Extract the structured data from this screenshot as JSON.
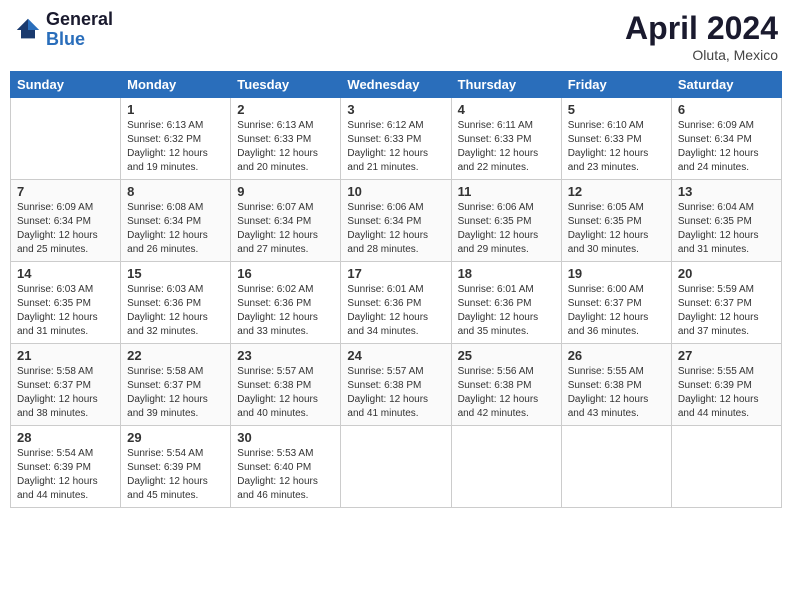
{
  "header": {
    "logo_line1": "General",
    "logo_line2": "Blue",
    "month_year": "April 2024",
    "location": "Oluta, Mexico"
  },
  "days_of_week": [
    "Sunday",
    "Monday",
    "Tuesday",
    "Wednesday",
    "Thursday",
    "Friday",
    "Saturday"
  ],
  "weeks": [
    [
      {
        "day": "",
        "info": ""
      },
      {
        "day": "1",
        "info": "Sunrise: 6:13 AM\nSunset: 6:32 PM\nDaylight: 12 hours\nand 19 minutes."
      },
      {
        "day": "2",
        "info": "Sunrise: 6:13 AM\nSunset: 6:33 PM\nDaylight: 12 hours\nand 20 minutes."
      },
      {
        "day": "3",
        "info": "Sunrise: 6:12 AM\nSunset: 6:33 PM\nDaylight: 12 hours\nand 21 minutes."
      },
      {
        "day": "4",
        "info": "Sunrise: 6:11 AM\nSunset: 6:33 PM\nDaylight: 12 hours\nand 22 minutes."
      },
      {
        "day": "5",
        "info": "Sunrise: 6:10 AM\nSunset: 6:33 PM\nDaylight: 12 hours\nand 23 minutes."
      },
      {
        "day": "6",
        "info": "Sunrise: 6:09 AM\nSunset: 6:34 PM\nDaylight: 12 hours\nand 24 minutes."
      }
    ],
    [
      {
        "day": "7",
        "info": "Sunrise: 6:09 AM\nSunset: 6:34 PM\nDaylight: 12 hours\nand 25 minutes."
      },
      {
        "day": "8",
        "info": "Sunrise: 6:08 AM\nSunset: 6:34 PM\nDaylight: 12 hours\nand 26 minutes."
      },
      {
        "day": "9",
        "info": "Sunrise: 6:07 AM\nSunset: 6:34 PM\nDaylight: 12 hours\nand 27 minutes."
      },
      {
        "day": "10",
        "info": "Sunrise: 6:06 AM\nSunset: 6:34 PM\nDaylight: 12 hours\nand 28 minutes."
      },
      {
        "day": "11",
        "info": "Sunrise: 6:06 AM\nSunset: 6:35 PM\nDaylight: 12 hours\nand 29 minutes."
      },
      {
        "day": "12",
        "info": "Sunrise: 6:05 AM\nSunset: 6:35 PM\nDaylight: 12 hours\nand 30 minutes."
      },
      {
        "day": "13",
        "info": "Sunrise: 6:04 AM\nSunset: 6:35 PM\nDaylight: 12 hours\nand 31 minutes."
      }
    ],
    [
      {
        "day": "14",
        "info": "Sunrise: 6:03 AM\nSunset: 6:35 PM\nDaylight: 12 hours\nand 31 minutes."
      },
      {
        "day": "15",
        "info": "Sunrise: 6:03 AM\nSunset: 6:36 PM\nDaylight: 12 hours\nand 32 minutes."
      },
      {
        "day": "16",
        "info": "Sunrise: 6:02 AM\nSunset: 6:36 PM\nDaylight: 12 hours\nand 33 minutes."
      },
      {
        "day": "17",
        "info": "Sunrise: 6:01 AM\nSunset: 6:36 PM\nDaylight: 12 hours\nand 34 minutes."
      },
      {
        "day": "18",
        "info": "Sunrise: 6:01 AM\nSunset: 6:36 PM\nDaylight: 12 hours\nand 35 minutes."
      },
      {
        "day": "19",
        "info": "Sunrise: 6:00 AM\nSunset: 6:37 PM\nDaylight: 12 hours\nand 36 minutes."
      },
      {
        "day": "20",
        "info": "Sunrise: 5:59 AM\nSunset: 6:37 PM\nDaylight: 12 hours\nand 37 minutes."
      }
    ],
    [
      {
        "day": "21",
        "info": "Sunrise: 5:58 AM\nSunset: 6:37 PM\nDaylight: 12 hours\nand 38 minutes."
      },
      {
        "day": "22",
        "info": "Sunrise: 5:58 AM\nSunset: 6:37 PM\nDaylight: 12 hours\nand 39 minutes."
      },
      {
        "day": "23",
        "info": "Sunrise: 5:57 AM\nSunset: 6:38 PM\nDaylight: 12 hours\nand 40 minutes."
      },
      {
        "day": "24",
        "info": "Sunrise: 5:57 AM\nSunset: 6:38 PM\nDaylight: 12 hours\nand 41 minutes."
      },
      {
        "day": "25",
        "info": "Sunrise: 5:56 AM\nSunset: 6:38 PM\nDaylight: 12 hours\nand 42 minutes."
      },
      {
        "day": "26",
        "info": "Sunrise: 5:55 AM\nSunset: 6:38 PM\nDaylight: 12 hours\nand 43 minutes."
      },
      {
        "day": "27",
        "info": "Sunrise: 5:55 AM\nSunset: 6:39 PM\nDaylight: 12 hours\nand 44 minutes."
      }
    ],
    [
      {
        "day": "28",
        "info": "Sunrise: 5:54 AM\nSunset: 6:39 PM\nDaylight: 12 hours\nand 44 minutes."
      },
      {
        "day": "29",
        "info": "Sunrise: 5:54 AM\nSunset: 6:39 PM\nDaylight: 12 hours\nand 45 minutes."
      },
      {
        "day": "30",
        "info": "Sunrise: 5:53 AM\nSunset: 6:40 PM\nDaylight: 12 hours\nand 46 minutes."
      },
      {
        "day": "",
        "info": ""
      },
      {
        "day": "",
        "info": ""
      },
      {
        "day": "",
        "info": ""
      },
      {
        "day": "",
        "info": ""
      }
    ]
  ]
}
